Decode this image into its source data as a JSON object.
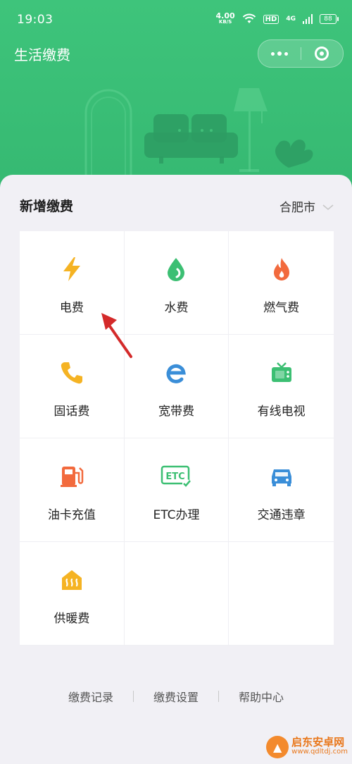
{
  "status": {
    "time": "19:03",
    "speed_value": "4.00",
    "speed_unit": "KB/S",
    "hd": "HD",
    "network": "4G",
    "battery": "88"
  },
  "header": {
    "title": "生活缴费"
  },
  "section": {
    "title": "新增缴费",
    "city": "合肥市"
  },
  "services": [
    {
      "label": "电费",
      "icon": "lightning-icon",
      "color": "#f5b323"
    },
    {
      "label": "水费",
      "icon": "water-drop-icon",
      "color": "#3cbf73"
    },
    {
      "label": "燃气费",
      "icon": "flame-icon",
      "color": "#f26a3d"
    },
    {
      "label": "固话费",
      "icon": "phone-icon",
      "color": "#f5b323"
    },
    {
      "label": "宽带费",
      "icon": "broadband-e-icon",
      "color": "#3a8ed8"
    },
    {
      "label": "有线电视",
      "icon": "tv-icon",
      "color": "#3cbf73"
    },
    {
      "label": "油卡充值",
      "icon": "fuel-pump-icon",
      "color": "#f26a3d"
    },
    {
      "label": "ETC办理",
      "icon": "etc-icon",
      "color": "#3cbf73"
    },
    {
      "label": "交通违章",
      "icon": "car-icon",
      "color": "#3a8ed8"
    },
    {
      "label": "供暖费",
      "icon": "heating-icon",
      "color": "#f5b323"
    }
  ],
  "footer": {
    "links": [
      "缴费记录",
      "缴费设置",
      "帮助中心"
    ]
  },
  "watermark": {
    "title": "启东安卓网",
    "url": "www.qdltdj.com"
  }
}
